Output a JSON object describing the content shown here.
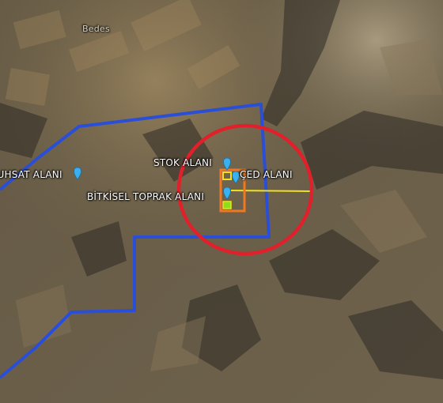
{
  "map": {
    "town_label": "Bedes",
    "placemarks": [
      {
        "label": "RUHSAT ALANI",
        "icon": "blue-placemark-icon"
      },
      {
        "label": "STOK ALANI",
        "icon": "blue-placemark-icon"
      },
      {
        "label": "ÇED ALANI",
        "icon": "blue-placemark-icon"
      },
      {
        "label": "BİTKİSEL TOPRAK ALANI",
        "icon": "blue-placemark-icon"
      }
    ],
    "colors": {
      "license_boundary": "#2a4fd6",
      "highlight_circle": "#e0202a",
      "site_polygon": "#f07820",
      "inner_zone": "#8ede1a",
      "yellow_line": "#f0e020",
      "placemark": "#3bb0f0"
    }
  }
}
